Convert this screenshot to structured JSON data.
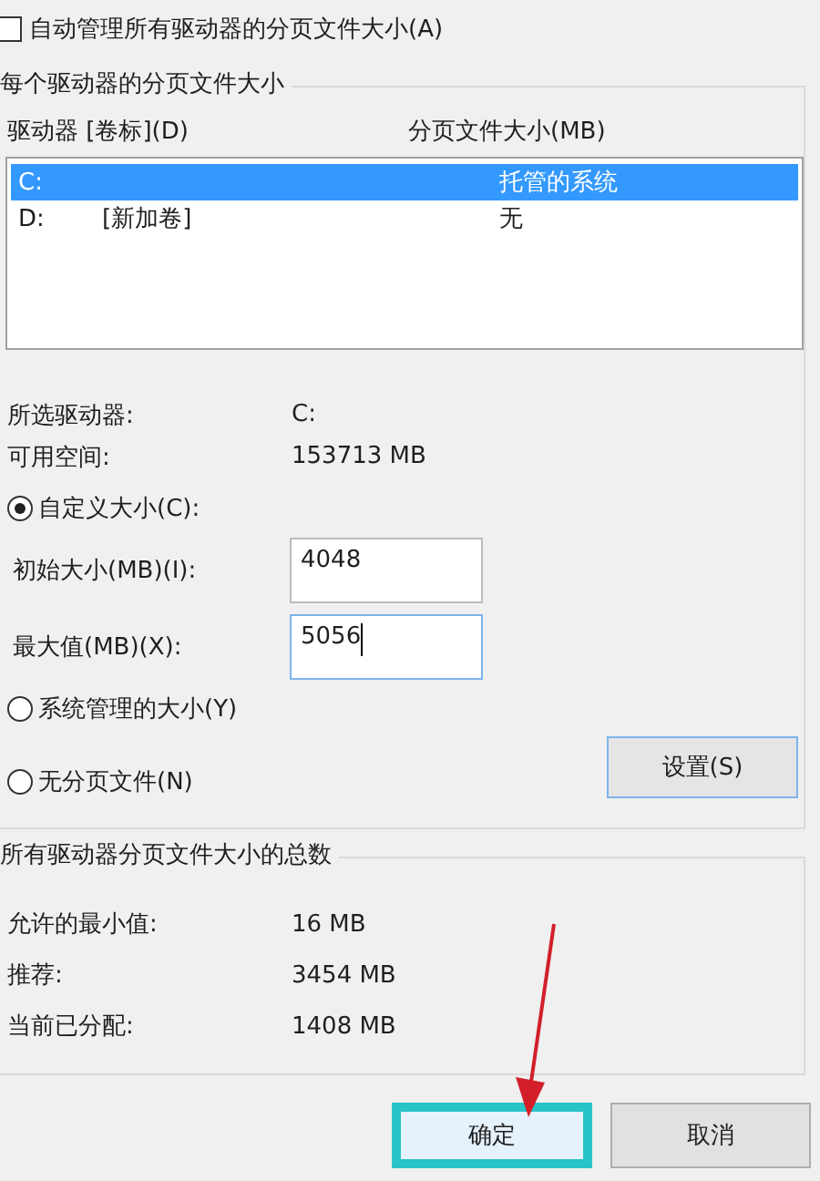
{
  "auto_manage": {
    "label": "自动管理所有驱动器的分页文件大小(A)",
    "checked": false
  },
  "per_drive": {
    "title": "每个驱动器的分页文件大小",
    "columns": [
      "驱动器 [卷标](D)",
      "分页文件大小(MB)"
    ],
    "rows": [
      {
        "drive": "C:",
        "size": "托管的系统",
        "selected": true
      },
      {
        "drive": "D:",
        "volume": "[新加卷]",
        "size": "无",
        "selected": false
      }
    ],
    "info": [
      {
        "label": "所选驱动器:",
        "value": "C:"
      },
      {
        "label": "可用空间:",
        "value": "153713 MB"
      }
    ],
    "options": [
      {
        "kind": "custom",
        "label": "自定义大小(C):",
        "selected": true
      },
      {
        "kind": "plain",
        "label": "系统管理的大小(Y)",
        "selected": false
      },
      {
        "kind": "plain",
        "label": "无分页文件(N)",
        "selected": false
      }
    ],
    "fields": [
      {
        "label": "初始大小(MB)(I):",
        "value": "4048",
        "focused": false
      },
      {
        "label": "最大值(MB)(X):",
        "value": "5056",
        "focused": true
      }
    ],
    "set_button": "设置(S)"
  },
  "totals": {
    "title": "所有驱动器分页文件大小的总数",
    "rows": [
      {
        "label": "允许的最小值:",
        "value": "16 MB"
      },
      {
        "label": "推荐:",
        "value": "3454 MB"
      },
      {
        "label": "当前已分配:",
        "value": "1408 MB"
      }
    ]
  },
  "buttons": [
    {
      "label": "确定",
      "focused": true
    },
    {
      "label": "取消",
      "focused": false
    }
  ],
  "annotations": [
    {
      "kind": "arrow"
    }
  ]
}
